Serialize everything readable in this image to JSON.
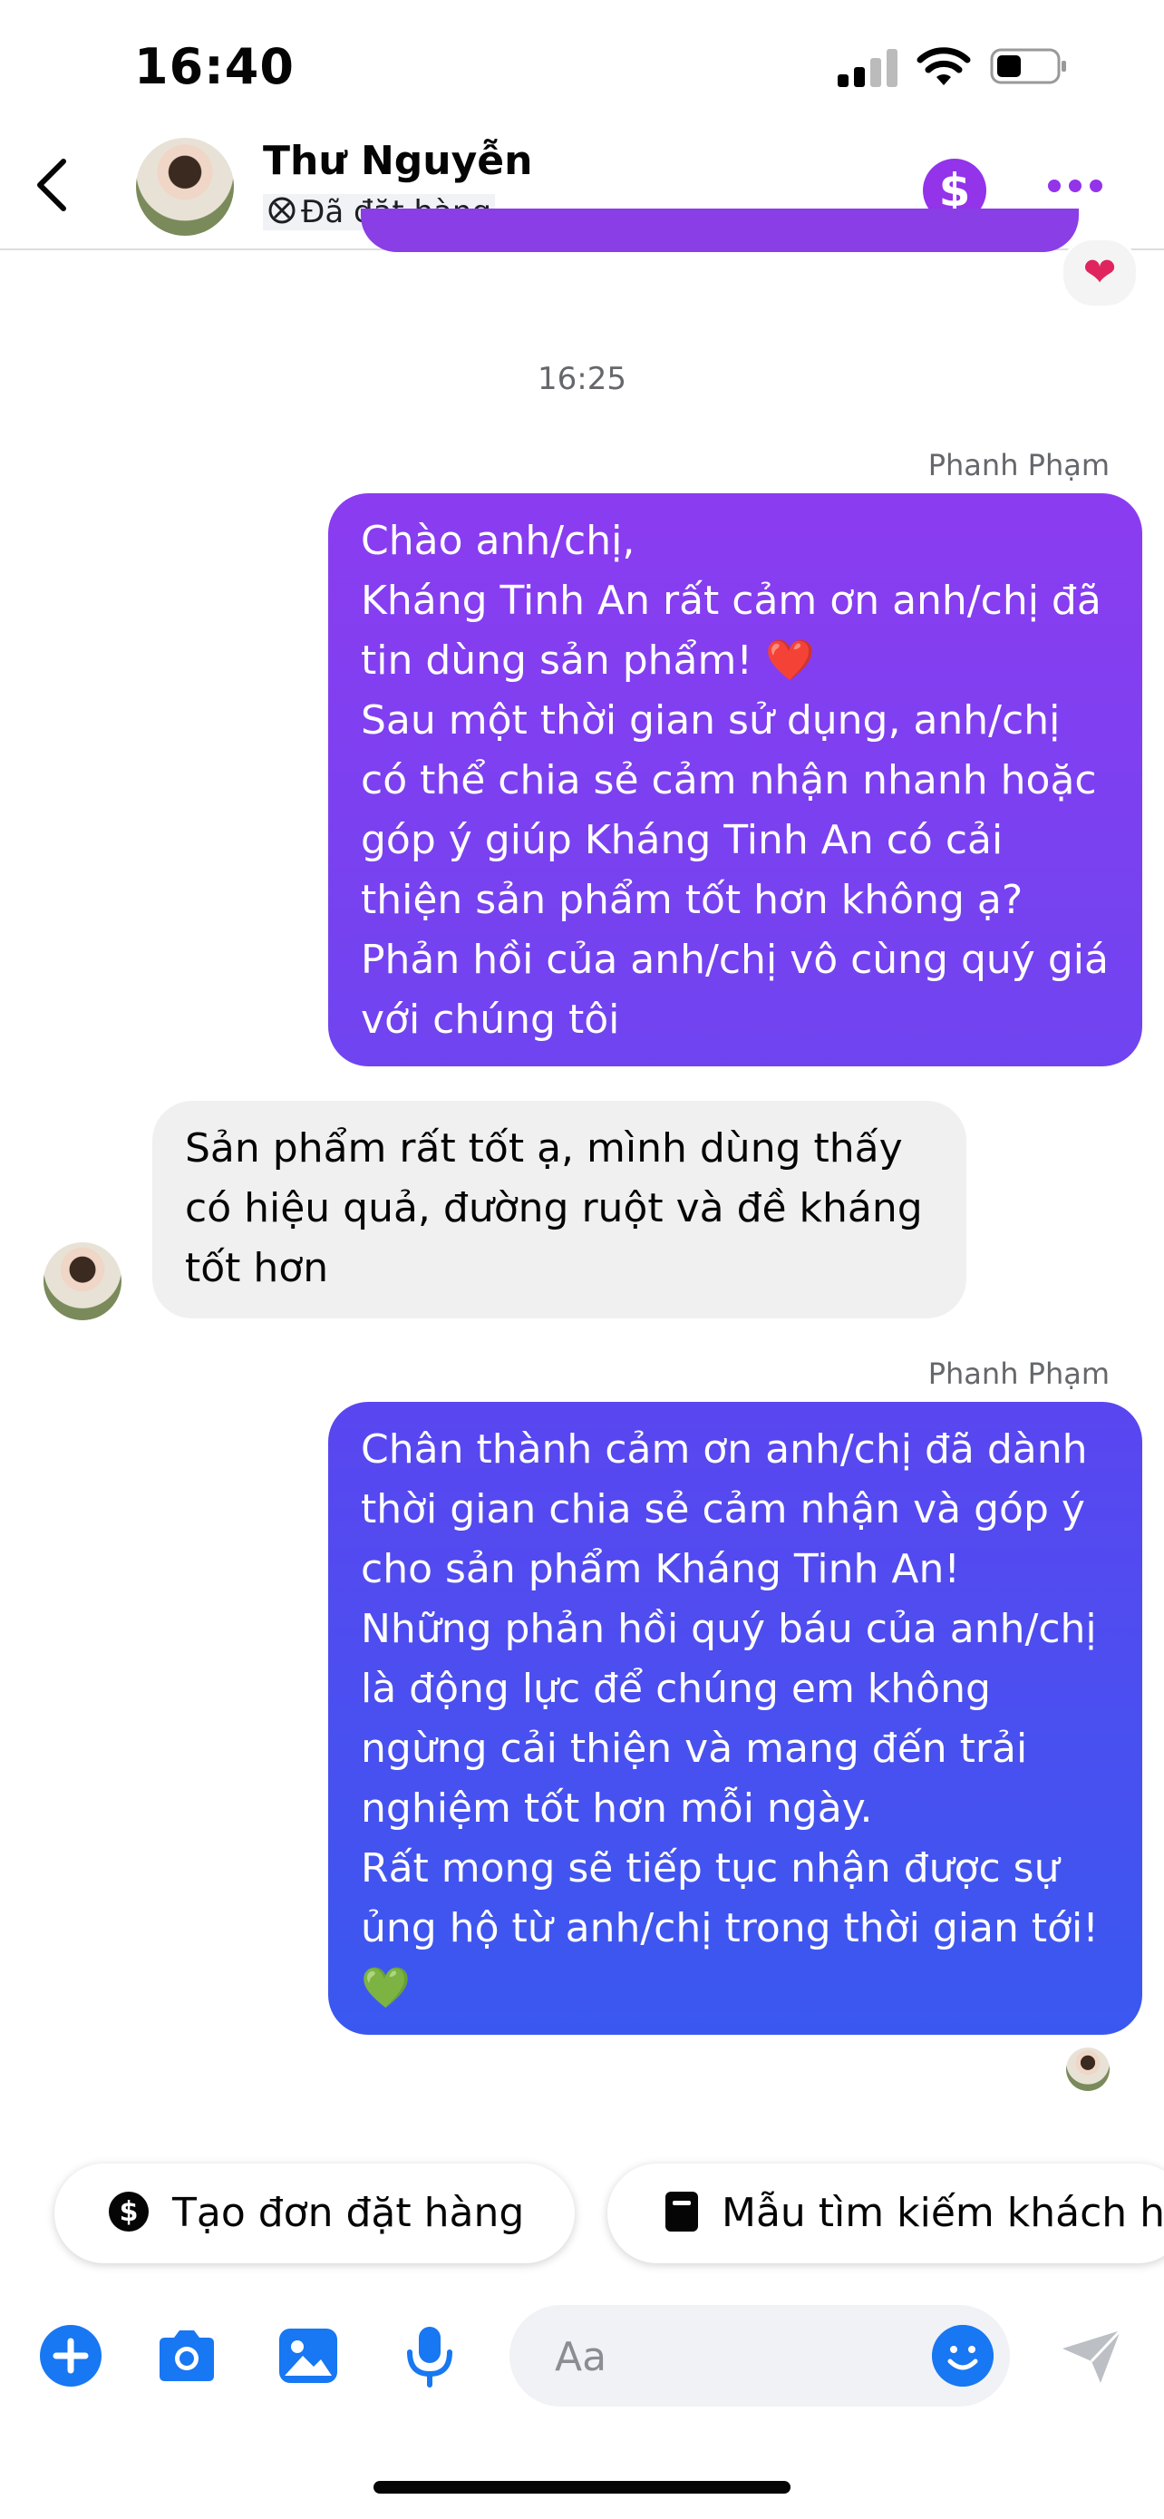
{
  "status_bar": {
    "time": "16:40"
  },
  "header": {
    "contact_name": "Thư Nguyễn",
    "order_status": "Đã đặt hàng",
    "pay_symbol": "$",
    "colors": {
      "accent": "#9333ea"
    }
  },
  "conversation": {
    "timestamp": "16:25",
    "previous_reaction": "❤",
    "messages": [
      {
        "direction": "outgoing",
        "sender_label": "Phanh Phạm",
        "text": "Chào anh/chị,\nKháng Tinh An rất cảm ơn anh/chị đã tin dùng sản phẩm! ❤️\nSau một thời gian sử dụng, anh/chị có thể chia sẻ cảm nhận nhanh hoặc góp ý giúp Kháng Tinh An có cải thiện sản phẩm tốt hơn không ạ? Phản hồi của anh/chị vô cùng quý giá với chúng tôi"
      },
      {
        "direction": "incoming",
        "text": "Sản phẩm rất tốt ạ, mình dùng thấy có hiệu quả, đường ruột và đề kháng tốt hơn"
      },
      {
        "direction": "outgoing",
        "sender_label": "Phanh Phạm",
        "text": "Chân thành cảm ơn anh/chị đã dành thời gian chia sẻ cảm nhận và góp ý cho sản phẩm Kháng Tinh An!\nNhững phản hồi quý báu của anh/chị là động lực để chúng em không ngừng cải thiện và mang đến trải nghiệm tốt hơn mỗi ngày.\nRất mong sẽ tiếp tục nhận được sự ủng hộ từ anh/chị trong thời gian tới! 💚"
      }
    ]
  },
  "quick_actions": [
    {
      "label": "Tạo đơn đặt hàng",
      "icon": "dollar-circle-icon"
    },
    {
      "label": "Mẫu tìm kiếm khách h",
      "icon": "form-icon"
    }
  ],
  "composer": {
    "placeholder": "Aa",
    "tools": [
      "plus-icon",
      "camera-icon",
      "gallery-icon",
      "microphone-icon"
    ],
    "colors": {
      "tool": "#1877f2"
    }
  }
}
